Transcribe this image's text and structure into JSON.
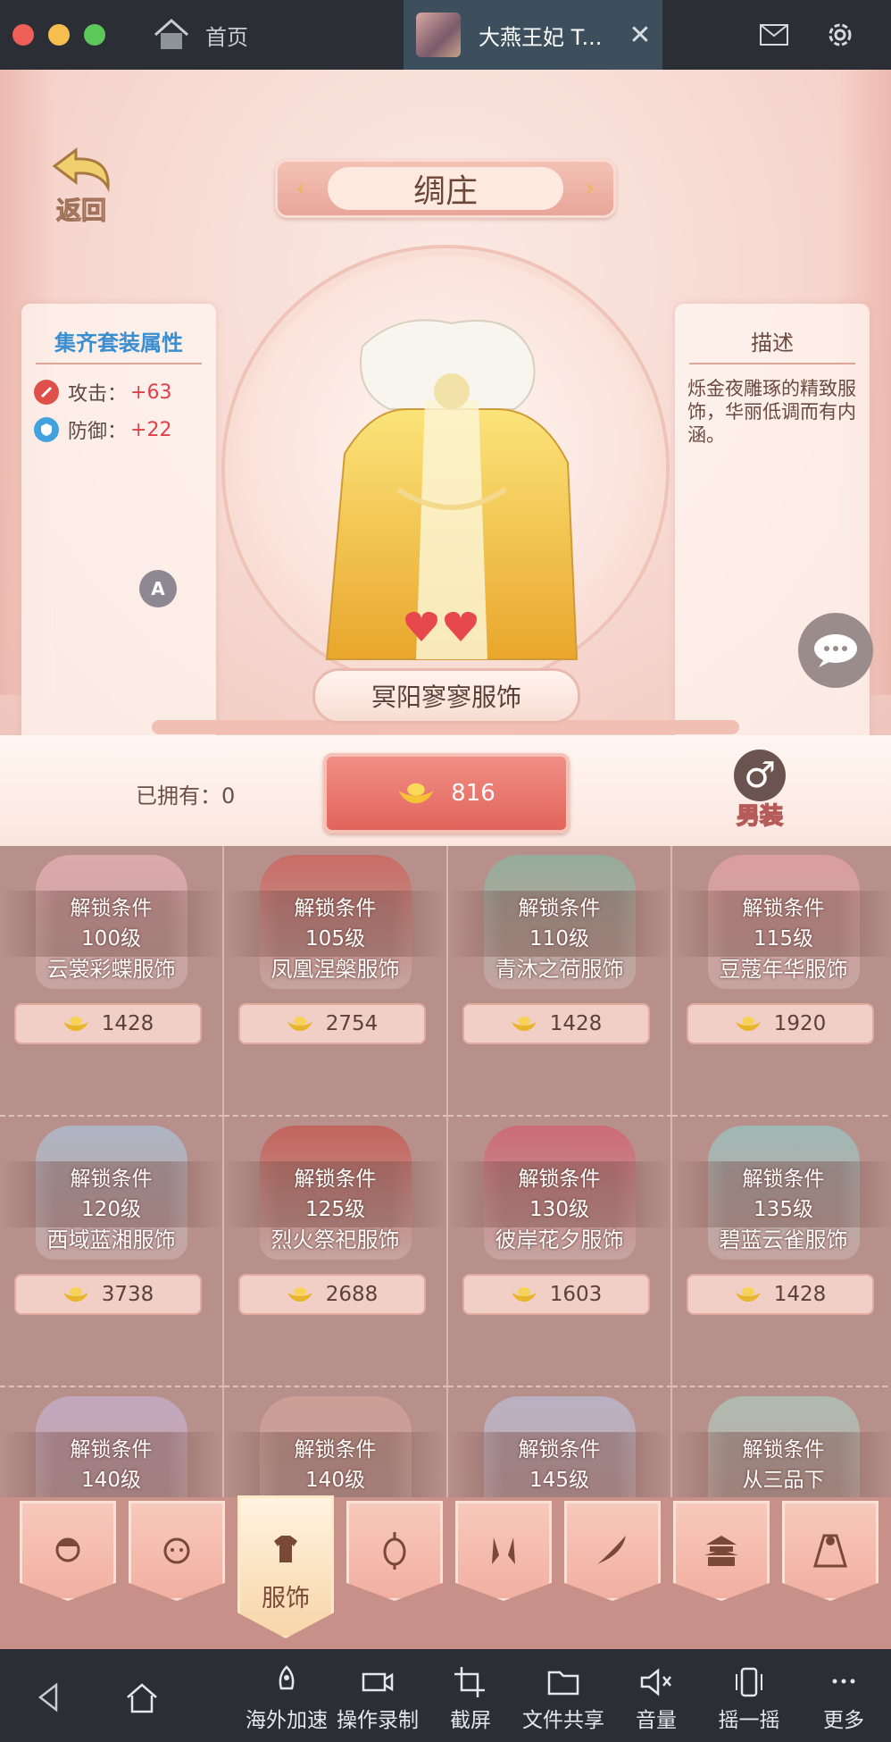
{
  "titlebar": {
    "home_label": "首页",
    "active_tab_title": "大燕王妃 T...",
    "close_glyph": "✕"
  },
  "game": {
    "back_label": "返回",
    "shop_title": "绸庄",
    "set_bonus": {
      "title": "集齐套装属性",
      "stats": [
        {
          "icon": "attack-icon",
          "label": "攻击：",
          "value": "+63"
        },
        {
          "icon": "defense-icon",
          "label": "防御：",
          "value": "+22"
        }
      ]
    },
    "description": {
      "title": "描述",
      "text": "烁金夜雕琢的精致服饰，华丽低调而有内涵。"
    },
    "badge_letter": "A",
    "selected_outfit_name": "冥阳寥寥服饰",
    "owned_label": "已拥有：0",
    "buy_price": "816",
    "gender_glyph": "♂",
    "gender_label": "男装",
    "items": [
      {
        "lock": "解锁条件",
        "level": "100级",
        "name": "云裳彩蝶服饰",
        "price": "1428",
        "color": "#f3b8c2"
      },
      {
        "lock": "解锁条件",
        "level": "105级",
        "name": "凤凰涅槃服饰",
        "price": "2754",
        "color": "#d2554d"
      },
      {
        "lock": "解锁条件",
        "level": "110级",
        "name": "青沐之荷服饰",
        "price": "1428",
        "color": "#7fbfa4"
      },
      {
        "lock": "解锁条件",
        "level": "115级",
        "name": "豆蔻年华服饰",
        "price": "1920",
        "color": "#f1a7ae"
      },
      {
        "lock": "解锁条件",
        "level": "120级",
        "name": "西域蓝湘服饰",
        "price": "3738",
        "color": "#a7cde8"
      },
      {
        "lock": "解锁条件",
        "level": "125级",
        "name": "烈火祭祀服饰",
        "price": "2688",
        "color": "#c9473d"
      },
      {
        "lock": "解锁条件",
        "level": "130级",
        "name": "彼岸花夕服饰",
        "price": "1603",
        "color": "#d9536a"
      },
      {
        "lock": "解锁条件",
        "level": "135级",
        "name": "碧蓝云雀服饰",
        "price": "1428",
        "color": "#8fd3d0"
      },
      {
        "lock": "解锁条件",
        "level": "140级",
        "name": "",
        "price": "",
        "color": "#c9b7e0"
      },
      {
        "lock": "解锁条件",
        "level": "140级",
        "name": "",
        "price": "",
        "color": "#d9a79d"
      },
      {
        "lock": "解锁条件",
        "level": "145级",
        "name": "",
        "price": "",
        "color": "#b9c7e8"
      },
      {
        "lock": "解锁条件",
        "level": "从三品下",
        "name": "",
        "price": "",
        "color": "#a9d7c8"
      }
    ],
    "tabs": [
      {
        "icon": "hairstyle-icon",
        "label": ""
      },
      {
        "icon": "face-icon",
        "label": ""
      },
      {
        "icon": "clothing-icon",
        "label": "服饰",
        "active": true
      },
      {
        "icon": "lantern-icon",
        "label": ""
      },
      {
        "icon": "earring-icon",
        "label": ""
      },
      {
        "icon": "feather-icon",
        "label": ""
      },
      {
        "icon": "temple-icon",
        "label": ""
      },
      {
        "icon": "cloak-icon",
        "label": ""
      }
    ]
  },
  "navbar": {
    "items": [
      {
        "icon": "back-icon",
        "label": ""
      },
      {
        "icon": "home-icon",
        "label": ""
      },
      {
        "icon": "rocket-icon",
        "label": "海外加速"
      },
      {
        "icon": "video-icon",
        "label": "操作录制"
      },
      {
        "icon": "crop-icon",
        "label": "截屏"
      },
      {
        "icon": "folder-icon",
        "label": "文件共享"
      },
      {
        "icon": "mute-icon",
        "label": "音量"
      },
      {
        "icon": "shake-icon",
        "label": "摇一摇"
      },
      {
        "icon": "more-icon",
        "label": "更多"
      }
    ]
  }
}
